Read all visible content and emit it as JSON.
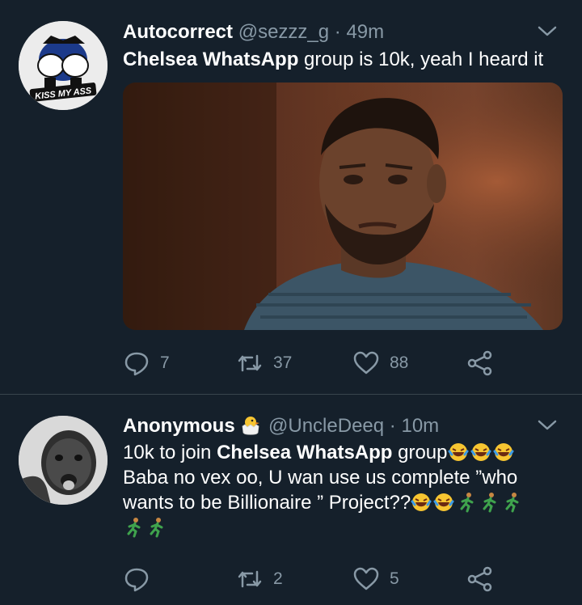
{
  "colors": {
    "background": "#15202b",
    "muted": "#8899a6",
    "divider": "#38444d"
  },
  "tweets": [
    {
      "name": "Autocorrect",
      "handle": "@sezzz_g",
      "separator": "·",
      "time": "49m",
      "text_bold": "Chelsea WhatsApp",
      "text_rest": " group is 10k, yeah I heard it",
      "avatar_caption": "KISS MY ASS",
      "counts": {
        "reply": "7",
        "retweet": "37",
        "like": "88"
      }
    },
    {
      "name": "Anonymous",
      "name_emoji": "hatching-chick-emoji",
      "handle": "@UncleDeeq",
      "separator": "·",
      "time": "10m",
      "line1_pre": "10k to join ",
      "line1_bold": "Chelsea WhatsApp",
      "line1_post": " group",
      "line2": "Baba no vex oo, U wan use us complete  ”who",
      "line3": "wants to be Billionaire ” Project??",
      "counts": {
        "retweet": "2",
        "like": "5"
      }
    }
  ]
}
